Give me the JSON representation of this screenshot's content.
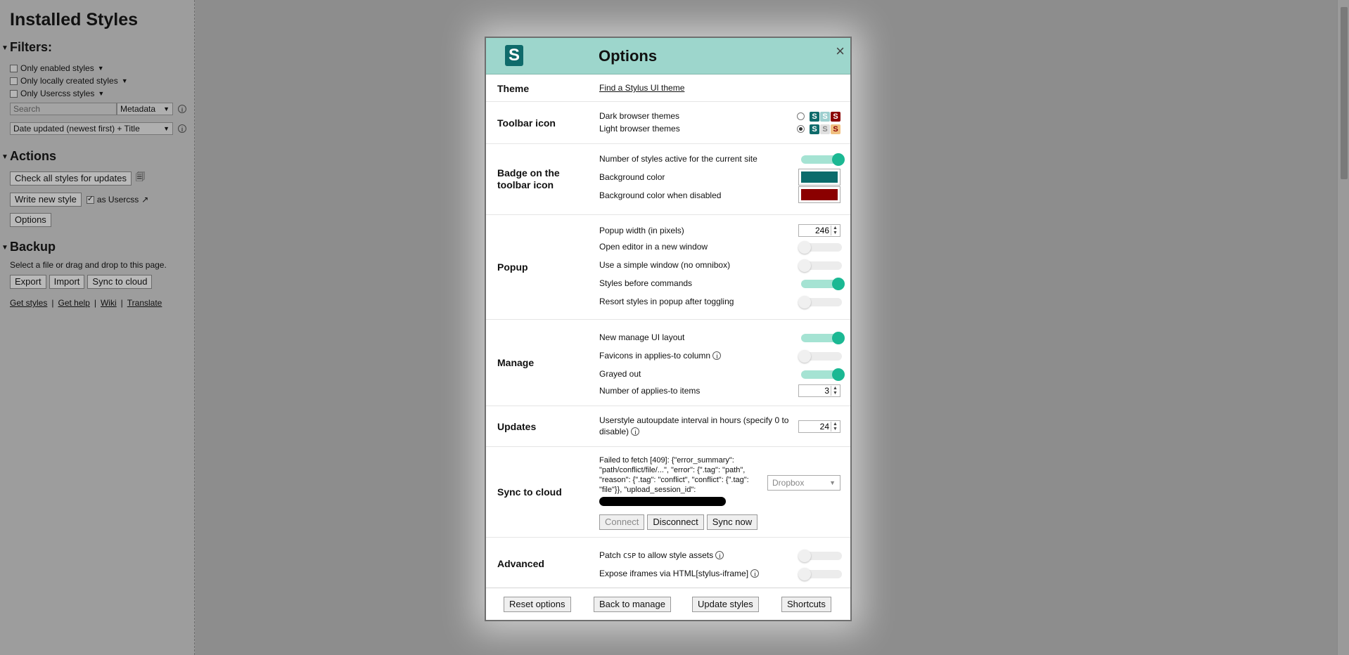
{
  "sidebar": {
    "title": "Installed Styles",
    "filters_heading": "Filters:",
    "filters": [
      "Only enabled styles",
      "Only locally created styles",
      "Only Usercss styles"
    ],
    "search_placeholder": "Search",
    "search_mode": "Metadata",
    "sort": "Date updated (newest first) + Title",
    "actions_heading": "Actions",
    "check_updates": "Check all styles for updates",
    "write_new": "Write new style",
    "as_usercss": "as Usercss",
    "options": "Options",
    "backup_heading": "Backup",
    "backup_text": "Select a file or drag and drop to this page.",
    "export": "Export",
    "import": "Import",
    "sync": "Sync to cloud",
    "links": [
      "Get styles",
      "Get help",
      "Wiki",
      "Translate"
    ]
  },
  "modal": {
    "logo": "S",
    "title": "Options",
    "close": "×",
    "theme": {
      "label": "Theme",
      "link": "Find a Stylus UI theme"
    },
    "toolbar_icon": {
      "label": "Toolbar icon",
      "dark": "Dark browser themes",
      "light": "Light browser themes",
      "selected": "light"
    },
    "badge": {
      "label": "Badge on the toolbar icon",
      "count": "Number of styles active for the current site",
      "bg": "Background color",
      "bg_disabled": "Background color when disabled",
      "bg_color": "#0b6b6b",
      "bg_disabled_color": "#8b0000",
      "count_on": true
    },
    "popup": {
      "label": "Popup",
      "width_label": "Popup width (in pixels)",
      "width": "246",
      "new_window": "Open editor in a new window",
      "simple_window": "Use a simple window (no omnibox)",
      "styles_before": "Styles before commands",
      "resort": "Resort styles in popup after toggling"
    },
    "manage": {
      "label": "Manage",
      "new_ui": "New manage UI layout",
      "favicons": "Favicons in applies-to column",
      "grayed": "Grayed out",
      "applies_count_label": "Number of applies-to items",
      "applies_count": "3"
    },
    "updates": {
      "label": "Updates",
      "interval_label": "Userstyle autoupdate interval in hours (specify 0 to disable)",
      "interval": "24"
    },
    "sync": {
      "label": "Sync to cloud",
      "error": "Failed to fetch [409]: {\"error_summary\": \"path/conflict/file/...\", \"error\": {\".tag\": \"path\", \"reason\": {\".tag\": \"conflict\", \"conflict\": {\".tag\": \"file\"}}, \"upload_session_id\":",
      "provider": "Dropbox",
      "connect": "Connect",
      "disconnect": "Disconnect",
      "sync_now": "Sync now"
    },
    "advanced": {
      "label": "Advanced",
      "patch_pre": "Patch ",
      "patch_csp": "CSP",
      "patch_post": " to allow style assets",
      "expose": "Expose iframes via HTML[stylus-iframe]"
    },
    "footer": {
      "reset": "Reset options",
      "back": "Back to manage",
      "update": "Update styles",
      "shortcuts": "Shortcuts"
    }
  },
  "colors": {
    "header_bg": "#9dd6cc",
    "toggle_on": "#1bb893",
    "accent": "#0f6b6b"
  }
}
